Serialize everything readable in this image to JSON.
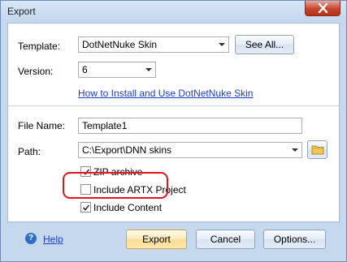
{
  "window": {
    "title": "Export"
  },
  "template": {
    "label": "Template:",
    "value": "DotNetNuke Skin",
    "see_all": "See All..."
  },
  "version": {
    "label": "Version:",
    "value": "6"
  },
  "install_link": "How to Install and Use DotNetNuke Skin",
  "file_name": {
    "label": "File Name:",
    "value": "Template1"
  },
  "path": {
    "label": "Path:",
    "value": "C:\\Export\\DNN skins"
  },
  "options": {
    "zip_archive": {
      "label": "ZIP archive",
      "checked": true
    },
    "include_artx": {
      "label": "Include ARTX Project",
      "checked": false
    },
    "include_content": {
      "label": "Include Content",
      "checked": true
    }
  },
  "footer": {
    "help": "Help",
    "export": "Export",
    "cancel": "Cancel",
    "options": "Options..."
  },
  "colors": {
    "highlight": "#e0141e",
    "link": "#1a3fcf",
    "close": "#c7432c"
  }
}
